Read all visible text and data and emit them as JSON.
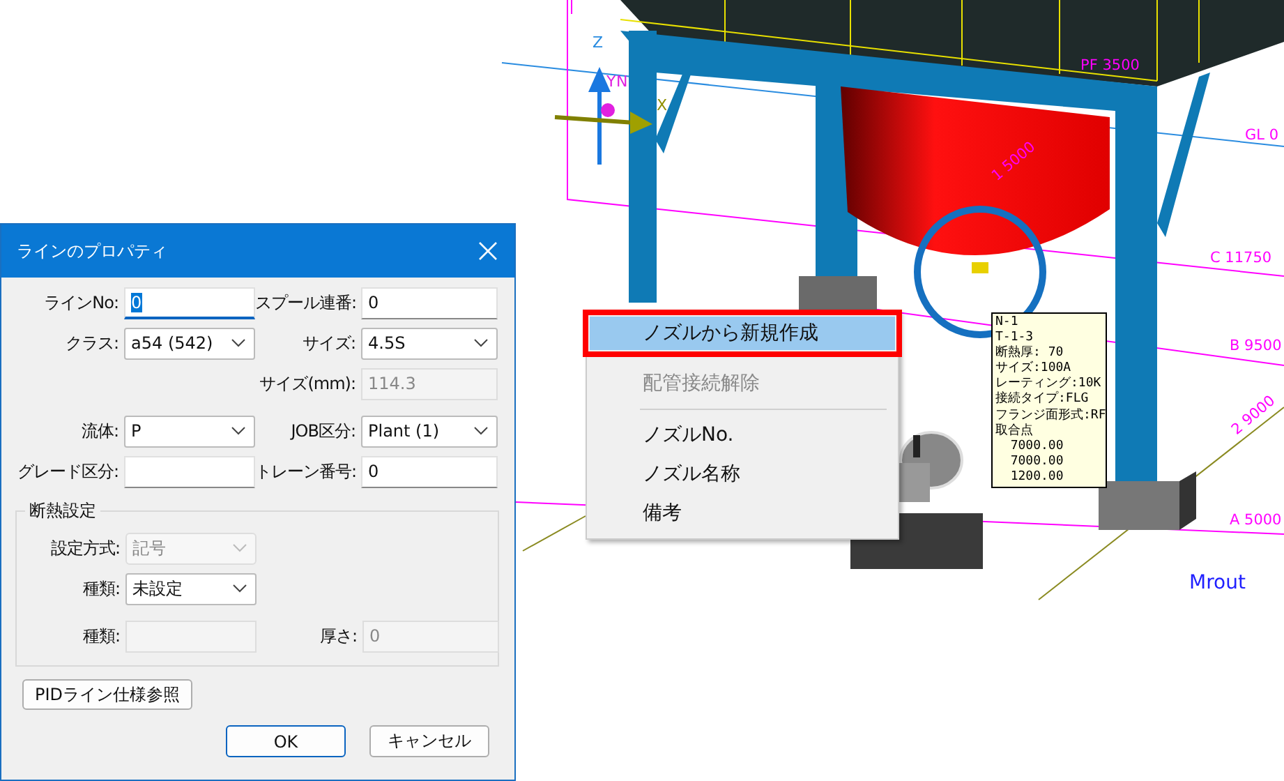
{
  "scene": {
    "axis_labels": [
      {
        "text": "Z",
        "kind": "z"
      },
      {
        "text": "Y",
        "kind": "y"
      },
      {
        "text": "N",
        "kind": "n"
      },
      {
        "text": "X",
        "kind": "x"
      }
    ],
    "grid_labels": [
      {
        "text": "PF 3500",
        "kind": "pf"
      },
      {
        "text": "GL 0",
        "kind": "gl"
      },
      {
        "text": "1 5000",
        "kind": "r1"
      },
      {
        "text": "C 11750",
        "kind": "c"
      },
      {
        "text": "B 9500",
        "kind": "b"
      },
      {
        "text": "2 9000",
        "kind": "r2"
      },
      {
        "text": "A 5000",
        "kind": "a"
      }
    ],
    "view_label": "Mrout",
    "tooltip": {
      "lines": [
        "N-1",
        "T-1-3",
        "断熱厚: 70",
        "サイズ:100A",
        "レーティング:10K",
        "接続タイプ:FLG",
        "フランジ面形式:RF",
        "取合点",
        "  7000.00",
        "  7000.00",
        "  1200.00"
      ]
    }
  },
  "context_menu": {
    "items": [
      {
        "kind": "item",
        "label": "ノズルから新規作成",
        "selected": true,
        "disabled": false,
        "annotated": true
      },
      {
        "kind": "item",
        "label": "配管接続解除",
        "selected": false,
        "disabled": true,
        "annotated": false
      },
      {
        "kind": "separator"
      },
      {
        "kind": "item",
        "label": "ノズルNo.",
        "selected": false,
        "disabled": false,
        "annotated": false
      },
      {
        "kind": "item",
        "label": "ノズル名称",
        "selected": false,
        "disabled": false,
        "annotated": false
      },
      {
        "kind": "item",
        "label": "備考",
        "selected": false,
        "disabled": false,
        "annotated": false
      }
    ]
  },
  "dialog": {
    "title": "ラインのプロパティ",
    "rows": [
      {
        "left": {
          "label": "ラインNo:",
          "kind": "text",
          "value": "0",
          "disabled": false,
          "focused": true
        },
        "right": {
          "label": "スプール連番:",
          "kind": "text",
          "value": "0",
          "disabled": false,
          "focused": false
        }
      },
      {
        "left": {
          "label": "クラス:",
          "kind": "select",
          "value": "a54 (542)",
          "disabled": false,
          "focused": false
        },
        "right": {
          "label": "サイズ:",
          "kind": "select",
          "value": "4.5S",
          "disabled": false,
          "focused": false
        }
      },
      {
        "right": {
          "label": "サイズ(mm):",
          "kind": "text",
          "value": "114.3",
          "disabled": true,
          "focused": false
        }
      },
      {
        "left": {
          "label": "流体:",
          "kind": "select",
          "value": "P",
          "disabled": false,
          "focused": false
        },
        "right": {
          "label": "JOB区分:",
          "kind": "select",
          "value": "Plant (1)",
          "disabled": false,
          "focused": false
        }
      },
      {
        "left": {
          "label": "グレード区分:",
          "kind": "text",
          "disabled": false,
          "focused": false
        },
        "right": {
          "label": "トレーン番号:",
          "kind": "text",
          "value": "0",
          "disabled": false,
          "focused": false
        }
      }
    ],
    "insulation": {
      "title": "断熱設定",
      "rows": [
        {
          "left": {
            "label": "設定方式:",
            "kind": "select",
            "value": "記号",
            "disabled": true,
            "focused": false
          }
        },
        {
          "left": {
            "label": "種類:",
            "kind": "select",
            "value": "未設定",
            "disabled": false,
            "focused": false
          }
        },
        {
          "left": {
            "label": "種類:",
            "kind": "text",
            "disabled": true,
            "focused": false
          },
          "right": {
            "label": "厚さ:",
            "kind": "text",
            "value": "0",
            "disabled": true,
            "focused": false
          }
        }
      ]
    },
    "reference_button": "PIDライン仕様参照",
    "buttons": [
      {
        "label": "OK",
        "default": true
      },
      {
        "label": "キャンセル",
        "default": false
      }
    ]
  }
}
